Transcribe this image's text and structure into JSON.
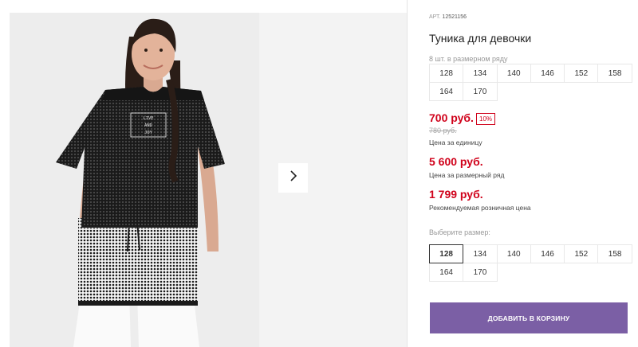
{
  "product": {
    "art_label": "АРТ.",
    "art_number": "12521156",
    "title": "Туника для девочки",
    "print_text": "LIVE AND JOY"
  },
  "size_range": {
    "label": "8 шт. в размерном ряду",
    "sizes": [
      "128",
      "134",
      "140",
      "146",
      "152",
      "158",
      "164",
      "170"
    ]
  },
  "prices": {
    "unit_price": "700 руб.",
    "discount_badge": "10%",
    "old_price": "780 руб.",
    "unit_caption": "Цена за единицу",
    "range_price": "5 600 руб.",
    "range_caption": "Цена за размерный ряд",
    "retail_price": "1 799 руб.",
    "retail_caption": "Рекомендуемая розничная цена"
  },
  "size_select": {
    "label": "Выберите размер:",
    "selected": "128",
    "sizes": [
      "128",
      "134",
      "140",
      "146",
      "152",
      "158",
      "164",
      "170"
    ]
  },
  "actions": {
    "add_to_cart": "ДОБАВИТЬ В КОРЗИНУ"
  },
  "icons": {
    "next": "chevron-right-icon"
  },
  "colors": {
    "price": "#d0021b",
    "button": "#7b5fa5",
    "photo_bg": "#ededed"
  }
}
